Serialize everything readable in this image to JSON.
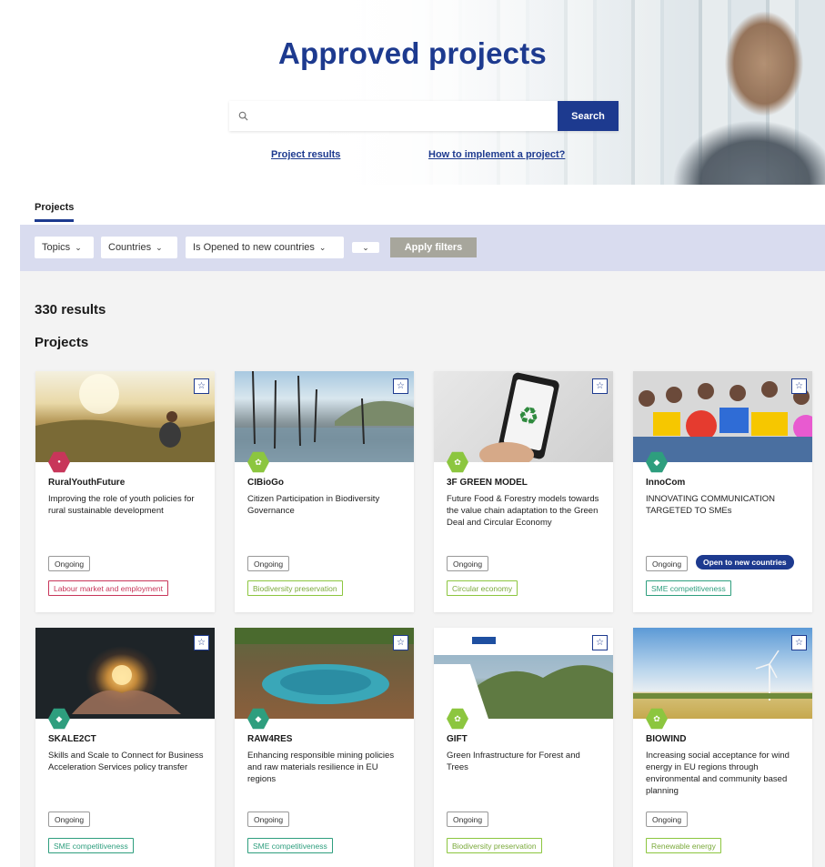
{
  "hero": {
    "title": "Approved projects",
    "search_placeholder": "",
    "search_button": "Search",
    "link_results": "Project results",
    "link_implement": "How to implement a project?"
  },
  "tabs": {
    "projects": "Projects"
  },
  "filters": {
    "topics": "Topics",
    "countries": "Countries",
    "opened": "Is Opened to new countries",
    "apply": "Apply filters"
  },
  "results": {
    "count": "330 results",
    "section": "Projects"
  },
  "colors": {
    "brand": "#1d3a8f",
    "filter_bar": "#d9dcef",
    "labour": "#c8365a",
    "green": "#8cc63f",
    "teal": "#2e9e7e"
  },
  "cards": [
    {
      "title": "RuralYouthFuture",
      "desc": "Improving the role of youth policies for rural sustainable development",
      "status": "Ongoing",
      "open": "",
      "topic": "Labour market and employment",
      "badge_icon": "youth-badge-icon",
      "badge_text": ""
    },
    {
      "title": "CIBioGo",
      "desc": "Citizen Participation in Biodiversity Governance",
      "status": "Ongoing",
      "open": "",
      "topic": "Biodiversity preservation",
      "badge_icon": "leaf-badge-icon",
      "badge_text": ""
    },
    {
      "title": "3F GREEN MODEL",
      "desc": "Future Food & Forestry models towards the value chain adaptation to the Green Deal and Circular Economy",
      "status": "Ongoing",
      "open": "",
      "topic": "Circular economy",
      "badge_icon": "leaf-badge-icon",
      "badge_text": ""
    },
    {
      "title": "InnoCom",
      "desc": "INNOVATING COMMUNICATION TARGETED TO SMEs",
      "status": "Ongoing",
      "open": "Open to new countries",
      "topic": "SME competitiveness",
      "badge_icon": "sme-badge-icon",
      "badge_text": ""
    },
    {
      "title": "SKALE2CT",
      "desc": "Skills and Scale to Connect for Business Acceleration Services policy transfer",
      "status": "Ongoing",
      "open": "",
      "topic": "SME competitiveness",
      "badge_icon": "sme-badge-icon",
      "badge_text": ""
    },
    {
      "title": "RAW4RES",
      "desc": "Enhancing responsible mining policies and raw materials resilience in EU regions",
      "status": "Ongoing",
      "open": "",
      "topic": "SME competitiveness",
      "badge_icon": "sme-badge-icon",
      "badge_text": ""
    },
    {
      "title": "GIFT",
      "desc": "Green Infrastructure for Forest and Trees",
      "status": "Ongoing",
      "open": "",
      "topic": "Biodiversity preservation",
      "badge_icon": "leaf-badge-icon",
      "badge_text": ""
    },
    {
      "title": "BIOWIND",
      "desc": "Increasing social acceptance for wind energy in EU regions through environmental and community based planning",
      "status": "Ongoing",
      "open": "",
      "topic": "Renewable energy",
      "badge_icon": "leaf-badge-icon",
      "badge_text": ""
    }
  ]
}
